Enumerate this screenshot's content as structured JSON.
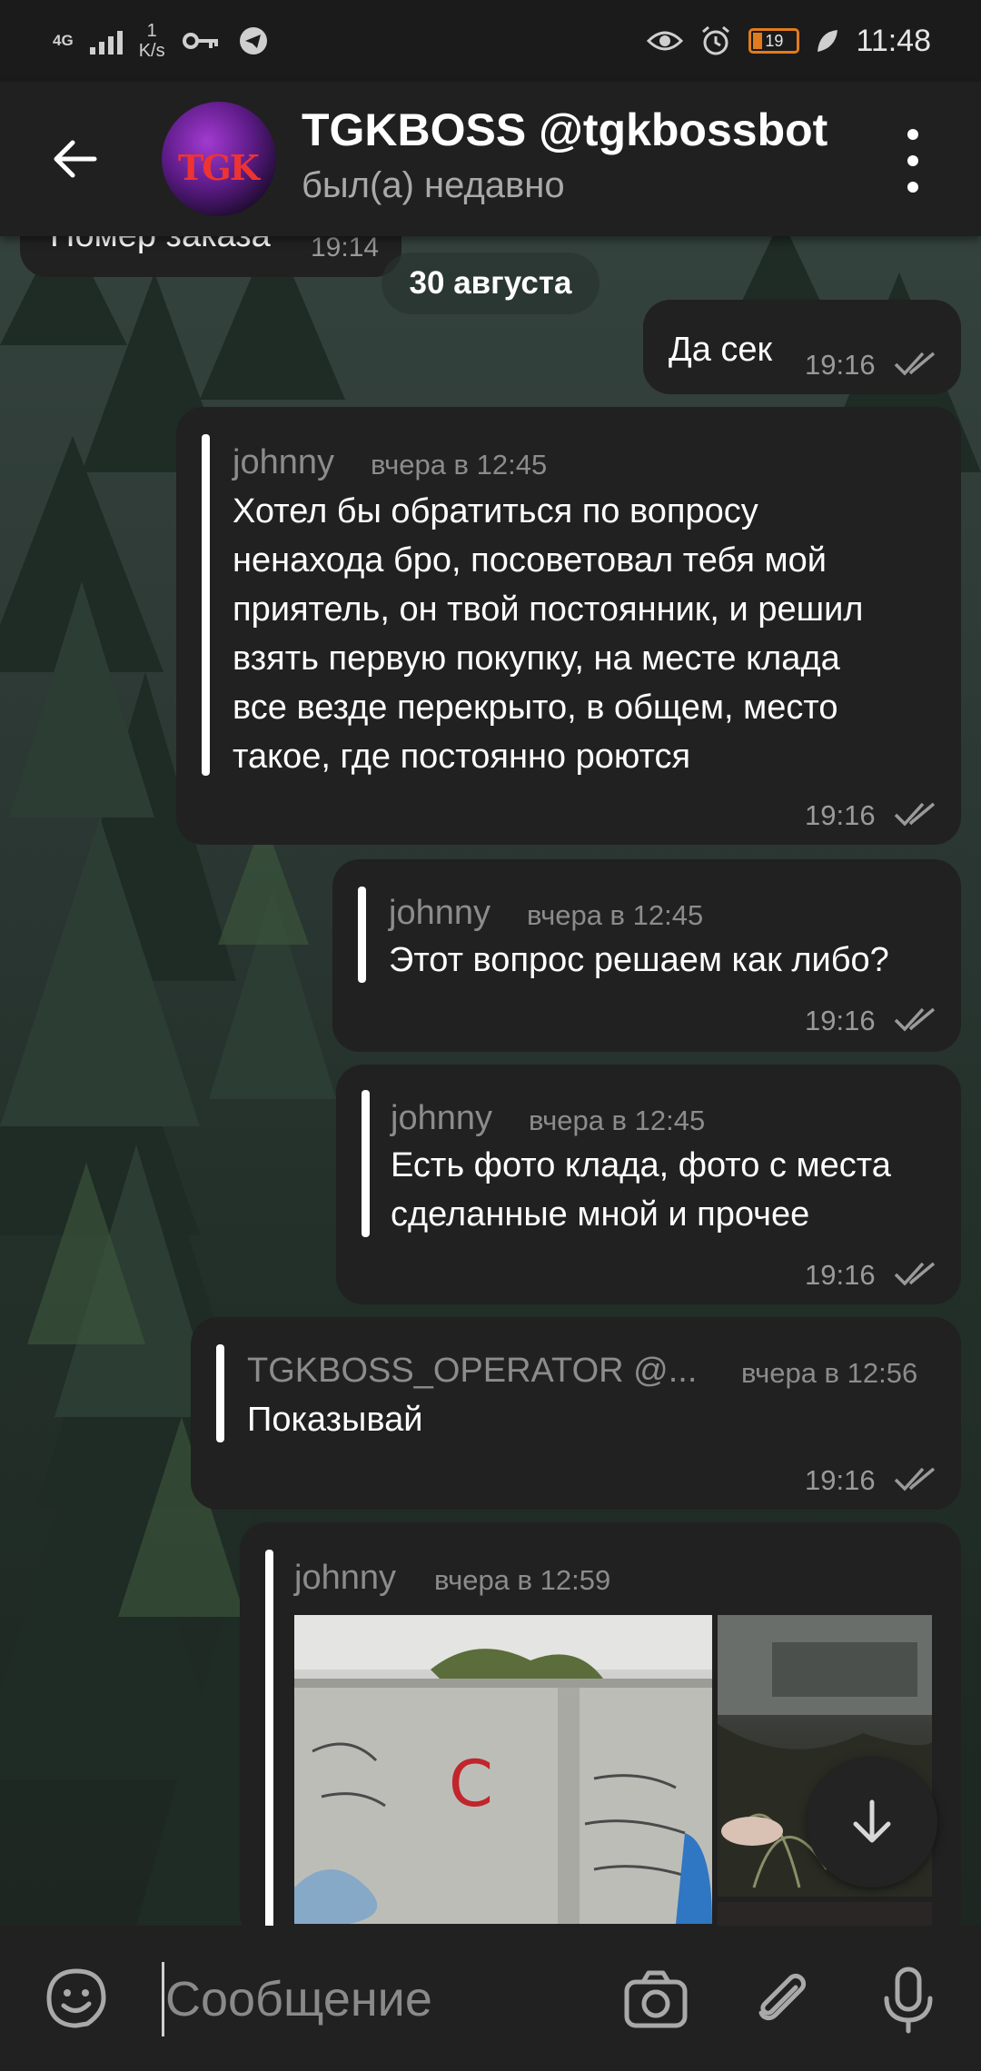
{
  "status_bar": {
    "signal_label": "4G",
    "net_speed_value": "1",
    "net_speed_unit": "K/s",
    "battery": "19",
    "time": "11:48"
  },
  "header": {
    "contact_name": "TGKBOSS @tgkbossbot",
    "contact_status": "был(а) недавно",
    "avatar_text": "TGK"
  },
  "messages": {
    "incoming_partial": {
      "text": "Номер заказа",
      "time": "19:14"
    },
    "date_separator": "30 августа",
    "out_1": {
      "text": "Да сек",
      "time": "19:16"
    },
    "out_2": {
      "fwd_name": "johnny",
      "fwd_when": "вчера в 12:45",
      "lines": [
        "Хотел бы обратиться по вопросу",
        "ненахода бро, посоветовал тебя мой",
        "приятель, он твой постоянник, и решил",
        "взять первую покупку, на месте клада",
        "все везде перекрыто, в общем, место",
        "такое, где постоянно роются"
      ],
      "time": "19:16"
    },
    "out_3": {
      "fwd_name": "johnny",
      "fwd_when": "вчера в 12:45",
      "text": "Этот вопрос решаем как либо?",
      "time": "19:16"
    },
    "out_4": {
      "fwd_name": "johnny",
      "fwd_when": "вчера в 12:45",
      "lines": [
        "Есть фото клада, фото с места",
        "сделанные мной и прочее"
      ],
      "time": "19:16"
    },
    "out_5": {
      "fwd_name": "TGKBOSS_OPERATOR @...",
      "fwd_when": "вчера в 12:56",
      "text": "Показывай",
      "time": "19:16"
    },
    "out_6": {
      "fwd_name": "johnny",
      "fwd_when": "вчера в 12:59",
      "photo_graffiti": "C"
    }
  },
  "input": {
    "placeholder": "Сообщение"
  },
  "icons": {
    "back": "arrow-left-icon",
    "menu": "more-vert-icon",
    "emoji": "sticker-icon",
    "camera": "camera-icon",
    "attach": "paperclip-icon",
    "mic": "microphone-icon",
    "scroll": "arrow-down-icon",
    "read": "double-check-icon"
  },
  "colors": {
    "bubble": "#212121",
    "header": "#202020",
    "battery_accent": "#e07c1e"
  }
}
